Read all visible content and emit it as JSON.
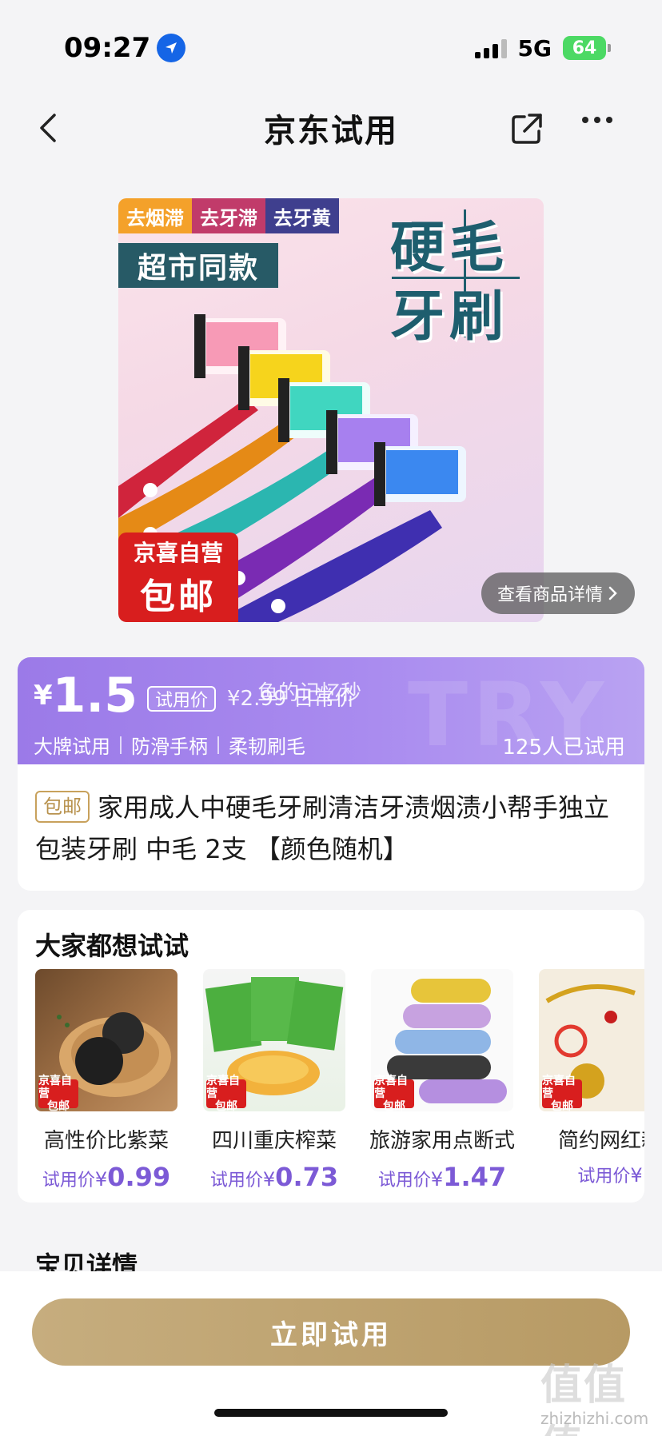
{
  "status_bar": {
    "time": "09:27",
    "network": "5G",
    "battery": "64"
  },
  "nav": {
    "title": "京东试用"
  },
  "product_image": {
    "tags": [
      "去烟滞",
      "去牙滞",
      "去牙黄"
    ],
    "promo": "超市同款",
    "big_title_line1": "硬毛",
    "big_title_line2": "牙刷",
    "badge_line1": "京喜自营",
    "badge_line2": "包邮",
    "details_link": "查看商品详情"
  },
  "price": {
    "currency": "¥",
    "value": "1.5",
    "trial_label": "试用价",
    "original": "¥2.99 日常价",
    "watermark_text": "鱼的记忆秒",
    "bg_watermark": "TRY",
    "features": [
      "大牌试用",
      "防滑手柄",
      "柔韧刷毛"
    ],
    "trial_count": "125人已试用"
  },
  "product": {
    "ship_tag": "包邮",
    "title": "家用成人中硬毛牙刷清洁牙渍烟渍小帮手独立包装牙刷 中毛 2支 【颜色随机】"
  },
  "recommend": {
    "title": "大家都想试试",
    "badge_line1": "京喜自营",
    "badge_line2": "包邮",
    "price_label": "试用价",
    "currency": "¥",
    "items": [
      {
        "name": "高性价比紫菜",
        "price": "0.99"
      },
      {
        "name": "四川重庆榨菜",
        "price": "0.73"
      },
      {
        "name": "旅游家用点断式",
        "price": "1.47"
      },
      {
        "name": "简约网红新",
        "price": ""
      }
    ]
  },
  "detail_section": {
    "title": "宝贝详情"
  },
  "action": {
    "try_now": "立即试用"
  },
  "site_watermark": {
    "mark": "值值值",
    "url": "zhizhizhi.com"
  },
  "colors": {
    "accent_purple": "#9b7ae8",
    "price_purple": "#7c5ad6",
    "gold_button": "#c6ad7e",
    "jd_red": "#d81e1e"
  }
}
